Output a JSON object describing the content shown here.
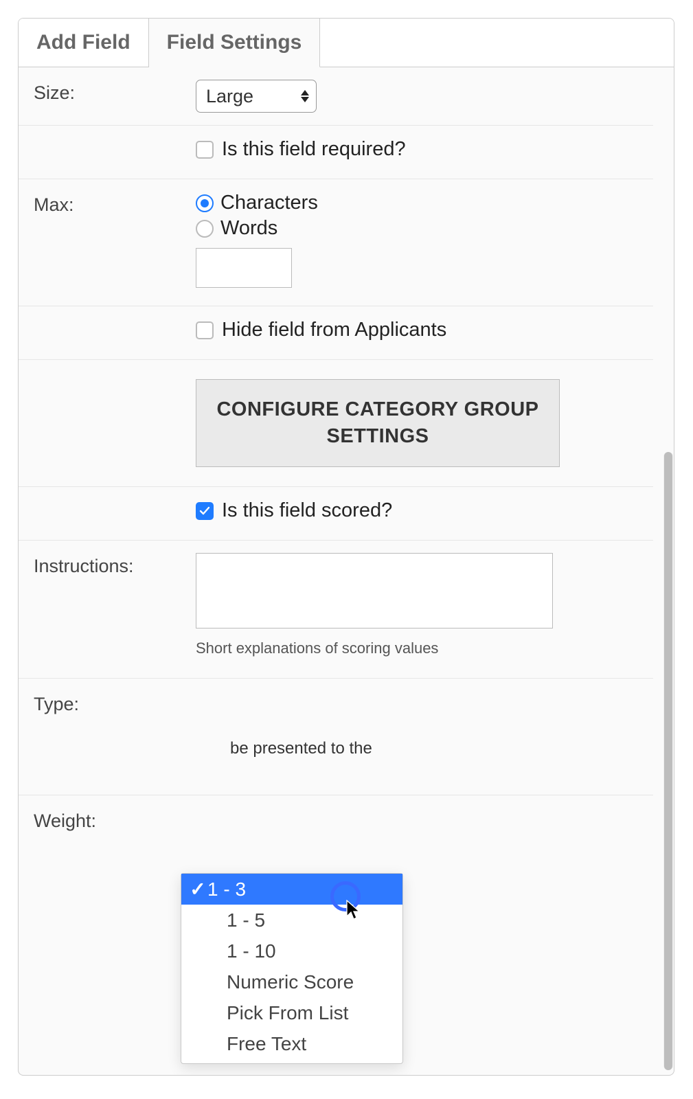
{
  "tabs": {
    "add_field": "Add Field",
    "field_settings": "Field Settings"
  },
  "labels": {
    "size": "Size:",
    "max": "Max:",
    "instructions": "Instructions:",
    "type": "Type:",
    "weight": "Weight:"
  },
  "size": {
    "value": "Large"
  },
  "required": {
    "label": "Is this field required?",
    "checked": false
  },
  "max": {
    "characters_label": "Characters",
    "words_label": "Words",
    "selected": "characters",
    "value": ""
  },
  "hide": {
    "label": "Hide field from Applicants",
    "checked": false
  },
  "config_button": "CONFIGURE CATEGORY GROUP SETTINGS",
  "scored": {
    "label": "Is this field scored?",
    "checked": true
  },
  "instructions_hint": "Short explanations of scoring values",
  "type_help": "be presented to the",
  "type_options": {
    "o1": "1 - 3",
    "o2": "1 - 5",
    "o3": "1 - 10",
    "o4": "Numeric Score",
    "o5": "Pick From List",
    "o6": "Free Text",
    "selected": "o1"
  }
}
